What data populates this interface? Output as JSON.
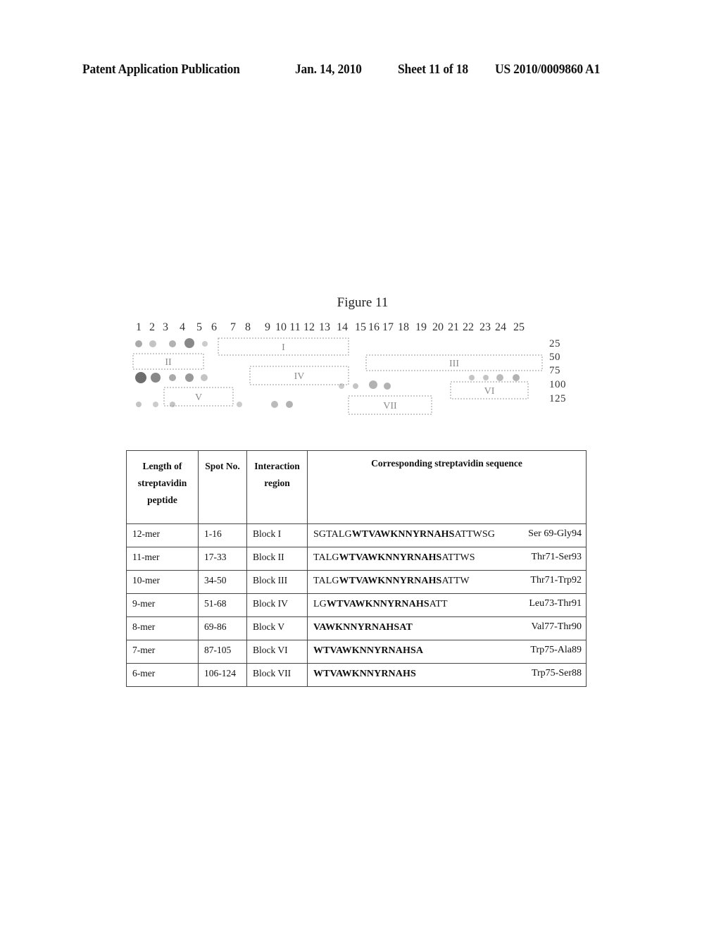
{
  "header": {
    "publication_type": "Patent Application Publication",
    "date": "Jan. 14, 2010",
    "sheet": "Sheet 11 of 18",
    "patent_number": "US 2010/0009860 A1"
  },
  "figure": {
    "title": "Figure 11",
    "lane_numbers": [
      "1",
      "2",
      "3",
      "4",
      "5",
      "6",
      "7",
      "8",
      "9",
      "10",
      "11",
      "12",
      "13",
      "14",
      "15",
      "16",
      "17",
      "18",
      "19",
      "20",
      "21",
      "22",
      "23",
      "24",
      "25"
    ],
    "spot_row_labels": [
      "25",
      "50",
      "75",
      "100",
      "125"
    ],
    "block_labels": [
      "I",
      "II",
      "III",
      "IV",
      "V",
      "VI",
      "VII"
    ]
  },
  "table": {
    "headers": {
      "length": [
        "Length of",
        "streptavidin",
        "peptide"
      ],
      "spot": "Spot No.",
      "region": [
        "Interaction",
        "region"
      ],
      "sequence": "Corresponding streptavidin sequence"
    },
    "rows": [
      {
        "length": "12-mer",
        "spot": "1-16",
        "region": "Block I",
        "seq_pre": "SGTALG",
        "seq_core": "WTVAWKNNYRNAHS",
        "seq_post": "ATTWSG",
        "range": "Ser 69-Gly94"
      },
      {
        "length": "11-mer",
        "spot": "17-33",
        "region": "Block II",
        "seq_pre": "TALG",
        "seq_core": "WTVAWKNNYRNAHS",
        "seq_post": "ATTWS",
        "range": "Thr71-Ser93"
      },
      {
        "length": "10-mer",
        "spot": "34-50",
        "region": "Block III",
        "seq_pre": "TALG",
        "seq_core": "WTVAWKNNYRNAHS",
        "seq_post": "ATTW",
        "range": "Thr71-Trp92"
      },
      {
        "length": "9-mer",
        "spot": "51-68",
        "region": "Block IV",
        "seq_pre": "LG",
        "seq_core": "WTVAWKNNYRNAHS",
        "seq_post": "ATT",
        "range": "Leu73-Thr91"
      },
      {
        "length": "8-mer",
        "spot": "69-86",
        "region": "Block V",
        "seq_pre": "",
        "seq_core": "VAWKNNYRNAHSAT",
        "seq_post": "",
        "range": "Val77-Thr90"
      },
      {
        "length": "7-mer",
        "spot": "87-105",
        "region": "Block VI",
        "seq_pre": "",
        "seq_core": "WTVAWKNNYRNAHSA",
        "seq_post": "",
        "range": "Trp75-Ala89"
      },
      {
        "length": "6-mer",
        "spot": "106-124",
        "region": "Block VII",
        "seq_pre": "",
        "seq_core": "WTVAWKNNYRNAHS",
        "seq_post": "",
        "range": "Trp75-Ser88"
      }
    ]
  }
}
